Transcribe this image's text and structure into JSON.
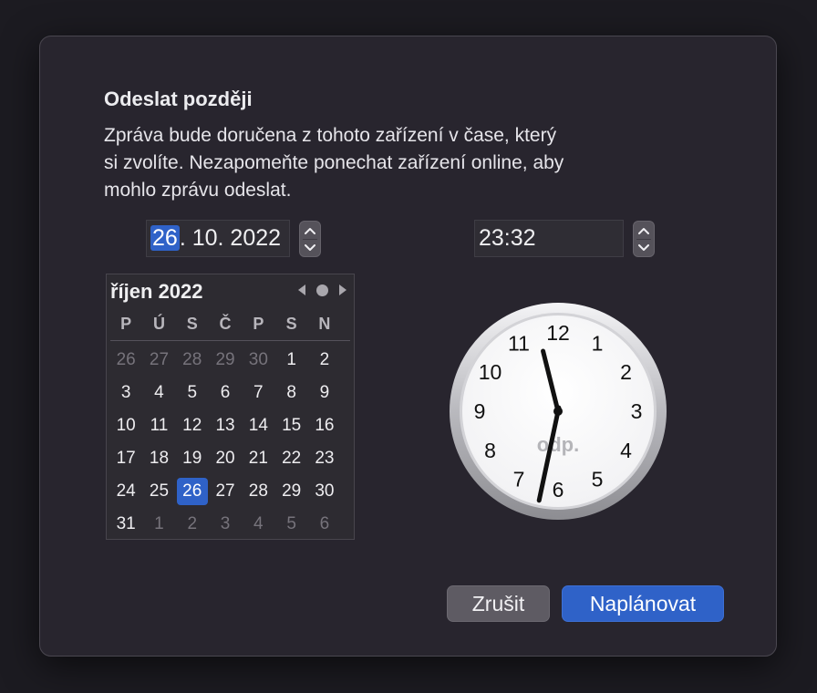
{
  "dialog": {
    "title": "Odeslat později",
    "description_lines": [
      "Zpráva bude doručena z tohoto zařízení v čase, který",
      "si zvolíte. Nezapomeňte ponechat zařízení online, aby",
      "mohlo zprávu odeslat."
    ]
  },
  "date_field": {
    "day": "26",
    "sep1": ".",
    "month": " 10.",
    "year": " 2022"
  },
  "time_field": {
    "value": "23:32"
  },
  "calendar": {
    "month_title": "říjen 2022",
    "weekdays": [
      "P",
      "Ú",
      "S",
      "Č",
      "P",
      "S",
      "N"
    ],
    "weeks": [
      [
        {
          "d": "26",
          "o": true
        },
        {
          "d": "27",
          "o": true
        },
        {
          "d": "28",
          "o": true
        },
        {
          "d": "29",
          "o": true
        },
        {
          "d": "30",
          "o": true
        },
        {
          "d": "1"
        },
        {
          "d": "2"
        }
      ],
      [
        {
          "d": "3"
        },
        {
          "d": "4"
        },
        {
          "d": "5"
        },
        {
          "d": "6"
        },
        {
          "d": "7"
        },
        {
          "d": "8"
        },
        {
          "d": "9"
        }
      ],
      [
        {
          "d": "10"
        },
        {
          "d": "11"
        },
        {
          "d": "12"
        },
        {
          "d": "13"
        },
        {
          "d": "14"
        },
        {
          "d": "15"
        },
        {
          "d": "16"
        }
      ],
      [
        {
          "d": "17"
        },
        {
          "d": "18"
        },
        {
          "d": "19"
        },
        {
          "d": "20"
        },
        {
          "d": "21"
        },
        {
          "d": "22"
        },
        {
          "d": "23"
        }
      ],
      [
        {
          "d": "24"
        },
        {
          "d": "25"
        },
        {
          "d": "26",
          "s": true
        },
        {
          "d": "27"
        },
        {
          "d": "28"
        },
        {
          "d": "29"
        },
        {
          "d": "30"
        }
      ],
      [
        {
          "d": "31"
        },
        {
          "d": "1",
          "o": true
        },
        {
          "d": "2",
          "o": true
        },
        {
          "d": "3",
          "o": true
        },
        {
          "d": "4",
          "o": true
        },
        {
          "d": "5",
          "o": true
        },
        {
          "d": "6",
          "o": true
        }
      ]
    ],
    "selected_day": "26"
  },
  "clock": {
    "numbers": [
      "12",
      "1",
      "2",
      "3",
      "4",
      "5",
      "6",
      "7",
      "8",
      "9",
      "10",
      "11"
    ],
    "period_label": "odp.",
    "hour": 11,
    "minute": 32
  },
  "buttons": {
    "cancel": "Zrušit",
    "confirm": "Naplánovat"
  },
  "colors": {
    "accent": "#2f62c8",
    "dialog_bg": "#28252e"
  },
  "icons": [
    "chevron-up-icon",
    "chevron-down-icon",
    "triangle-left-icon",
    "circle-today-icon",
    "triangle-right-icon"
  ]
}
